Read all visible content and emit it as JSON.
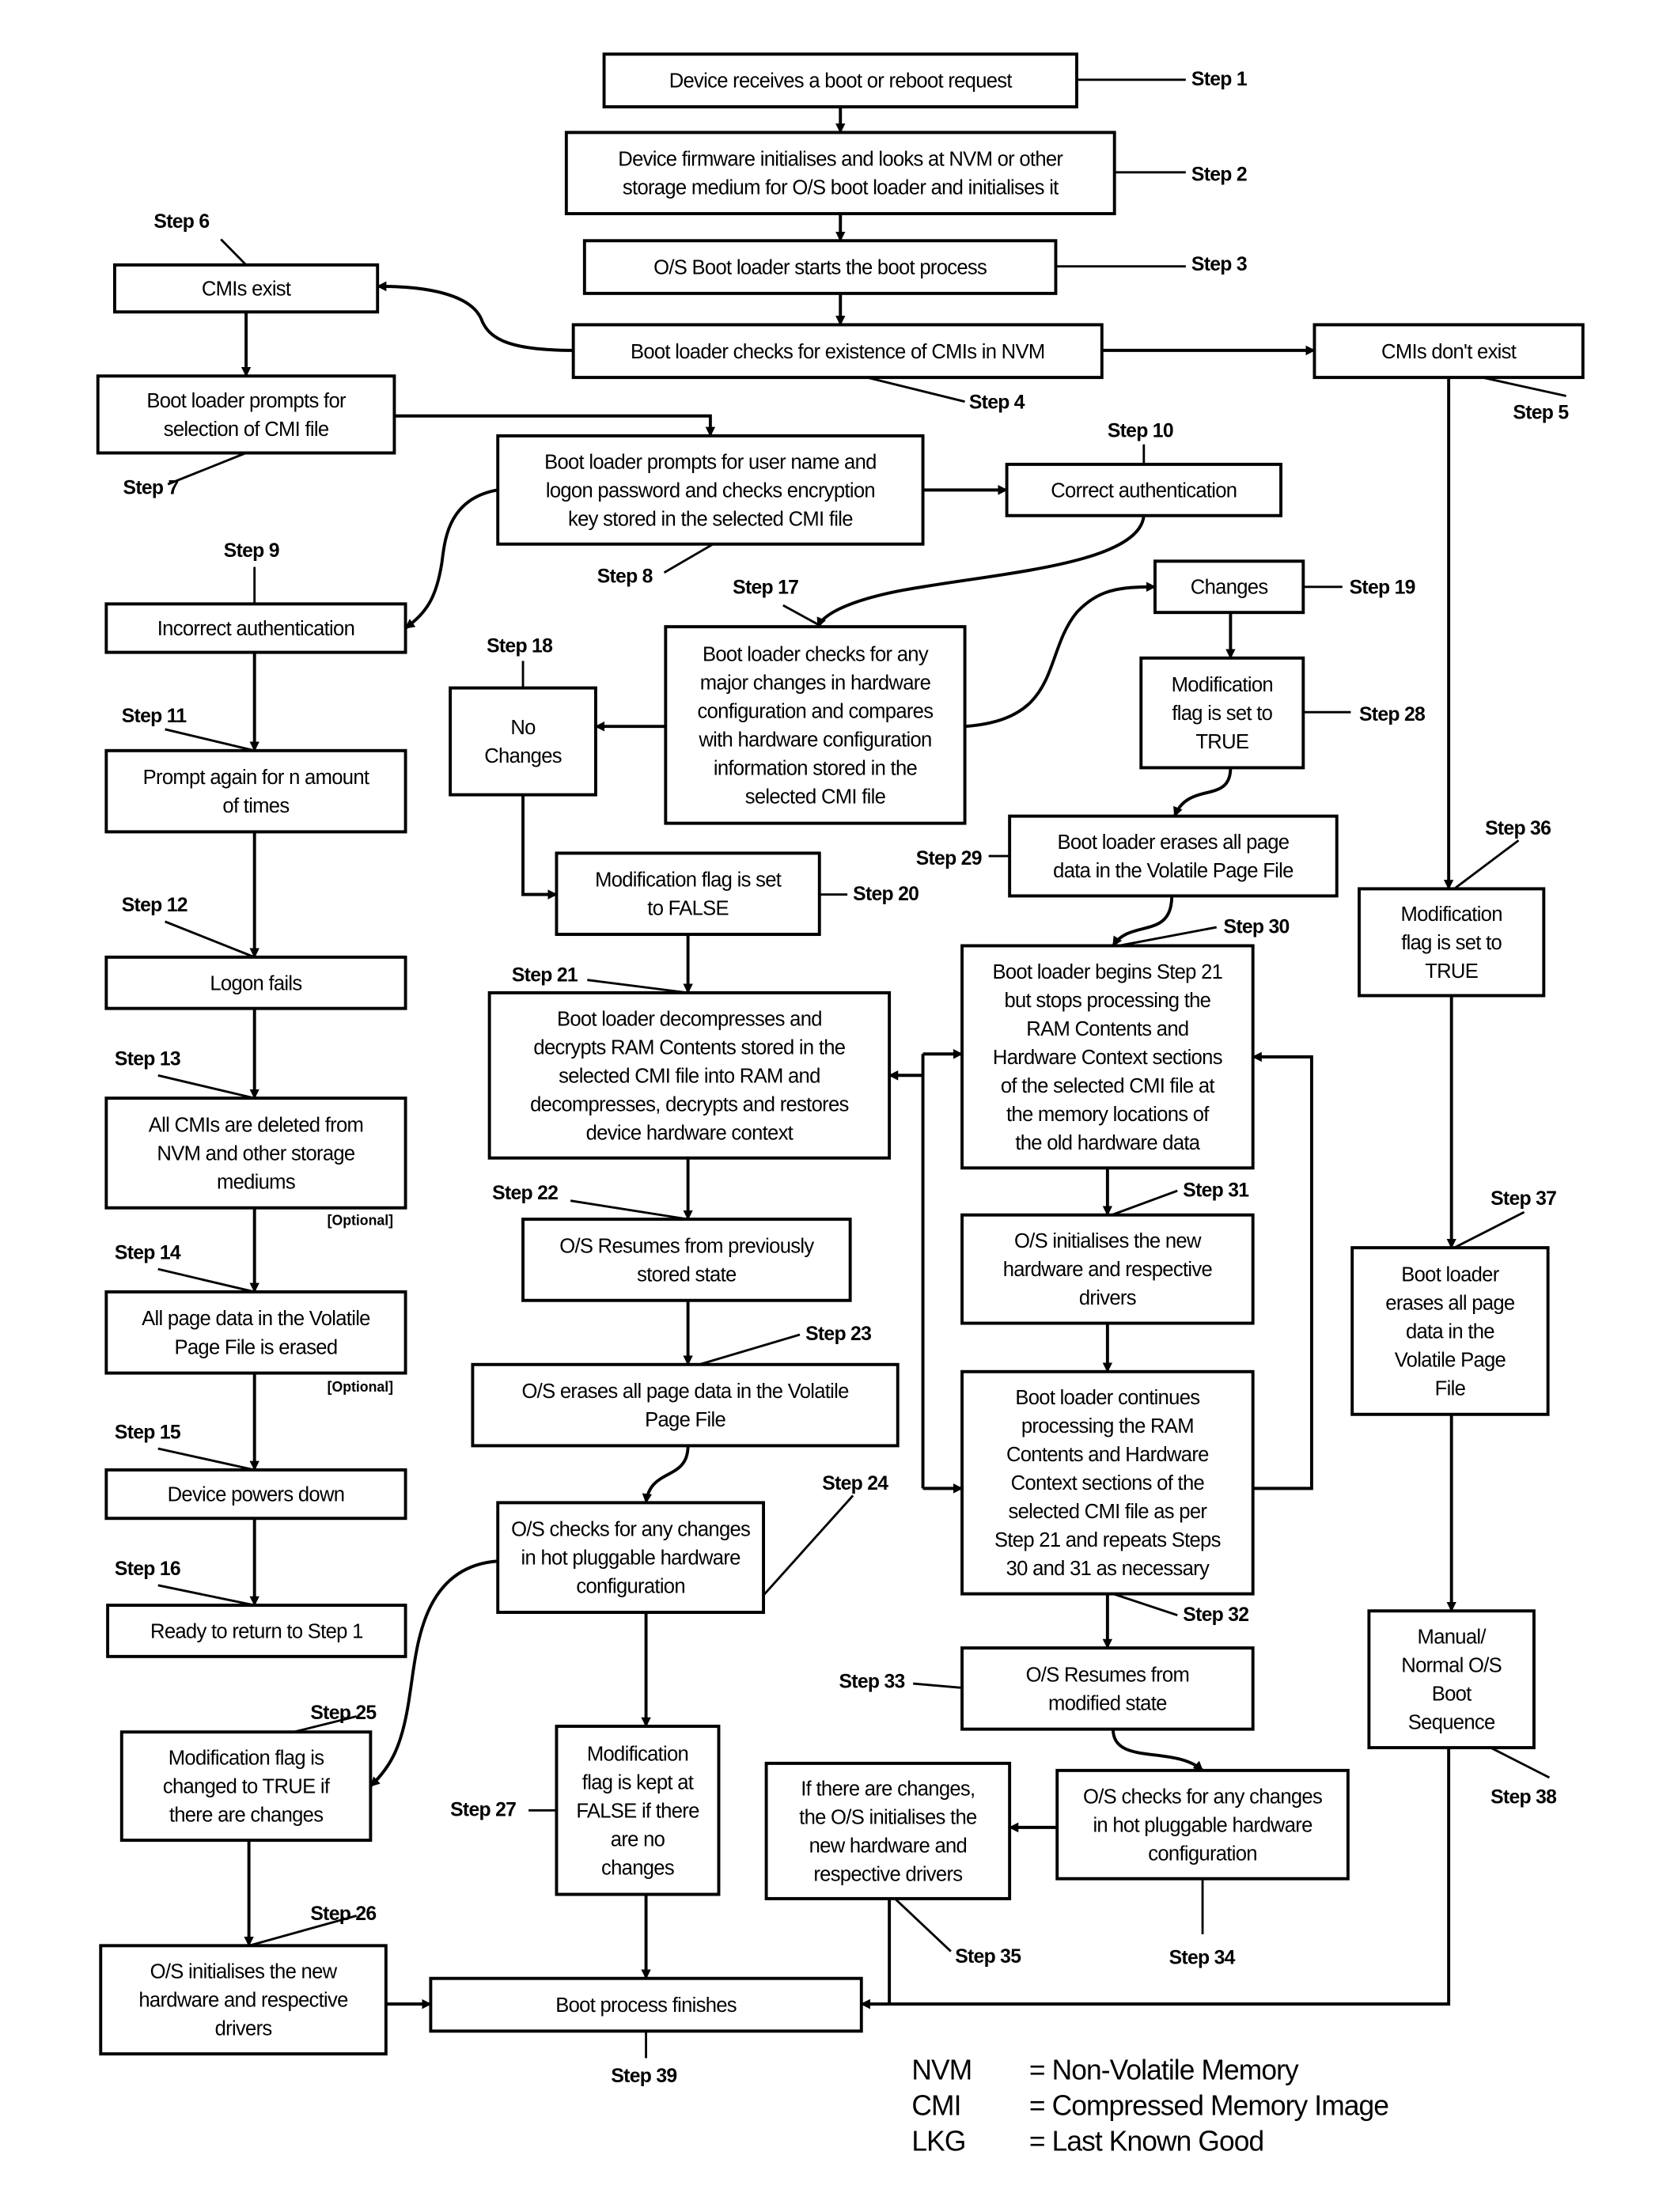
{
  "figure": {
    "boxes": {
      "s1": [
        "Device receives a boot or reboot request"
      ],
      "s2": [
        "Device firmware initialises and looks at NVM or other",
        "storage medium for O/S boot loader and initialises it"
      ],
      "s3": [
        "O/S Boot loader starts the boot process"
      ],
      "s4": [
        "Boot loader checks for existence of CMIs in NVM"
      ],
      "s5": [
        "CMIs don't exist"
      ],
      "s6": [
        "CMIs exist"
      ],
      "s7": [
        "Boot loader prompts for",
        "selection of CMI file"
      ],
      "s8": [
        "Boot loader prompts for user name and",
        "logon password and checks encryption",
        "key stored in the selected CMI file"
      ],
      "s9": [
        "Incorrect authentication"
      ],
      "s10": [
        "Correct authentication"
      ],
      "s11": [
        "Prompt again for n amount",
        "of times"
      ],
      "s12": [
        "Logon fails"
      ],
      "s13": [
        "All CMIs are deleted from",
        "NVM and other storage",
        "mediums"
      ],
      "s14": [
        "All page data in the Volatile",
        "Page File is erased"
      ],
      "s15": [
        "Device powers down"
      ],
      "s16": [
        "Ready to return to Step 1"
      ],
      "s17": [
        "Boot loader checks for any",
        "major changes in hardware",
        "configuration and compares",
        "with hardware configuration",
        "information stored in the",
        "selected CMI file"
      ],
      "s18": [
        "No",
        "Changes"
      ],
      "s19": [
        "Changes"
      ],
      "s20": [
        "Modification flag is set",
        "to FALSE"
      ],
      "s21": [
        "Boot loader decompresses and",
        "decrypts RAM Contents stored in the",
        "selected CMI file into RAM and",
        "decompresses, decrypts and restores",
        "device hardware context"
      ],
      "s22": [
        "O/S Resumes from previously",
        "stored state"
      ],
      "s23": [
        "O/S erases all page data in the Volatile",
        "Page File"
      ],
      "s24": [
        "O/S checks for any changes",
        "in hot pluggable hardware",
        "configuration"
      ],
      "s25": [
        "Modification flag is",
        "changed to TRUE if",
        "there are changes"
      ],
      "s26": [
        "O/S initialises the new",
        "hardware and respective",
        "drivers"
      ],
      "s27": [
        "Modification",
        "flag is kept at",
        "FALSE if there",
        "are no",
        "changes"
      ],
      "s28": [
        "Modification",
        "flag is set to",
        "TRUE"
      ],
      "s29": [
        "Boot loader erases all page",
        "data in the Volatile Page File"
      ],
      "s30": [
        "Boot loader begins Step 21",
        "but stops processing the",
        "RAM Contents and",
        "Hardware Context sections",
        "of the selected CMI file at",
        "the memory locations of",
        "the old hardware data"
      ],
      "s31": [
        "O/S initialises the new",
        "hardware and respective",
        "drivers"
      ],
      "s32": [
        "Boot loader continues",
        "processing the RAM",
        "Contents and Hardware",
        "Context sections of the",
        "selected CMI file as per",
        "Step 21 and repeats Steps",
        "30 and 31 as necessary"
      ],
      "s33": [
        "O/S Resumes from",
        "modified state"
      ],
      "s34": [
        "O/S checks for any changes",
        "in hot pluggable hardware",
        "configuration"
      ],
      "s35": [
        "If there are changes,",
        "the O/S initialises the",
        "new hardware and",
        "respective drivers"
      ],
      "s36": [
        "Modification",
        "flag is set to",
        "TRUE"
      ],
      "s37": [
        "Boot loader",
        "erases all page",
        "data in the",
        "Volatile Page",
        "File"
      ],
      "s38": [
        "Manual/",
        "Normal O/S",
        "Boot",
        "Sequence"
      ],
      "s39": [
        "Boot process finishes"
      ]
    },
    "step_labels": {
      "s1": "Step 1",
      "s2": "Step 2",
      "s3": "Step 3",
      "s4": "Step 4",
      "s5": "Step 5",
      "s6": "Step 6",
      "s7": "Step 7",
      "s8": "Step 8",
      "s9": "Step 9",
      "s10": "Step 10",
      "s11": "Step 11",
      "s12": "Step 12",
      "s13": "Step 13",
      "s14": "Step 14",
      "s15": "Step 15",
      "s16": "Step 16",
      "s17": "Step 17",
      "s18": "Step 18",
      "s19": "Step 19",
      "s20": "Step 20",
      "s21": "Step 21",
      "s22": "Step 22",
      "s23": "Step 23",
      "s24": "Step 24",
      "s25": "Step 25",
      "s26": "Step 26",
      "s27": "Step 27",
      "s28": "Step 28",
      "s29": "Step 29",
      "s30": "Step 30",
      "s31": "Step 31",
      "s32": "Step 32",
      "s33": "Step 33",
      "s34": "Step 34",
      "s35": "Step 35",
      "s36": "Step 36",
      "s37": "Step 37",
      "s38": "Step 38",
      "s39": "Step 39"
    },
    "optional_label": "[Optional]",
    "legend": [
      {
        "abbr": "NVM",
        "meaning": "= Non-Volatile Memory"
      },
      {
        "abbr": "CMI",
        "meaning": "= Compressed Memory Image"
      },
      {
        "abbr": "LKG",
        "meaning": "= Last Known Good"
      }
    ]
  }
}
